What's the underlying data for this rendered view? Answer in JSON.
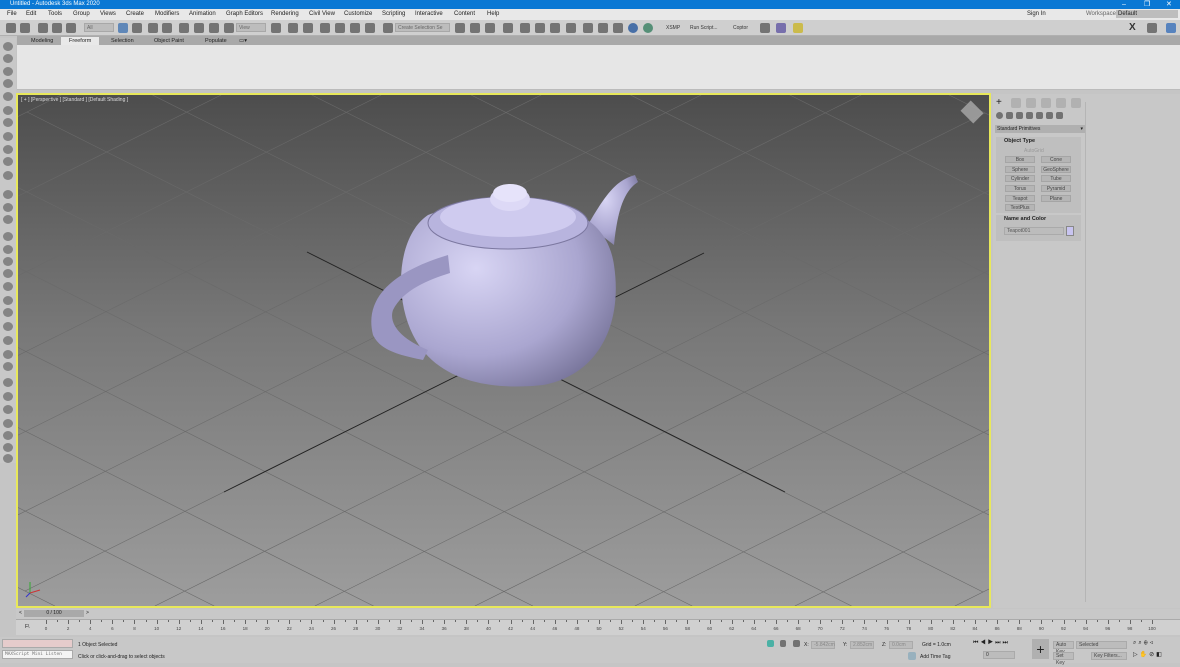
{
  "window": {
    "title": "Untitled - Autodesk 3ds Max 2020",
    "minimize": "–",
    "restore": "❐",
    "close": "✕"
  },
  "menu": [
    "File",
    "Edit",
    "Tools",
    "Group",
    "Views",
    "Create",
    "Modifiers",
    "Animation",
    "Graph Editors",
    "Rendering",
    "Civil View",
    "Customize",
    "Scripting",
    "Interactive",
    "Content",
    "Help"
  ],
  "account": {
    "sign_in": "Sign In",
    "workspaces_label": "Workspaces:",
    "workspace": "Default"
  },
  "toolbar": {
    "filter": "All",
    "ref_coord": "View",
    "selection_set": "Create Selection Se",
    "xsmp": "XSMP",
    "run_script": "Run Script...",
    "coptor": "Coptor",
    "x_label": "X"
  },
  "ribbon": {
    "tabs": [
      "Modeling",
      "Freeform",
      "Selection",
      "Object Paint",
      "Populate"
    ],
    "active_tab": "Freeform"
  },
  "viewport": {
    "label": "[ + ] [Perspective ] [Standard ] [Default Shading ]",
    "accent": "#e8e85a"
  },
  "command_panel": {
    "category": "Standard Primitives",
    "object_type_title": "Object Type",
    "autogrid": "AutoGrid",
    "buttons": [
      "Box",
      "Cone",
      "Sphere",
      "GeoSphere",
      "Cylinder",
      "Tube",
      "Torus",
      "Pyramid",
      "Teapot",
      "Plane",
      "TextPlus"
    ],
    "name_color_title": "Name and Color",
    "object_name": "Teapot001",
    "object_color": "#c8c4f0"
  },
  "timeline": {
    "frame": "0 / 100",
    "start": 0,
    "end": 100,
    "step": 2
  },
  "status": {
    "maxscript": "MAXScript Mini Listen",
    "selected": "1 Object Selected",
    "prompt": "Click or click-and-drag to select objects",
    "x_label": "X:",
    "x": "-5.842cm",
    "y_label": "Y:",
    "y": "2.852cm",
    "z_label": "Z:",
    "z": "0.0cm",
    "grid": "Grid = 1.0cm",
    "add_time_tag": "Add Time Tag",
    "auto_key": "Auto Key",
    "set_key": "Set Key",
    "key_mode": "Selected",
    "key_filters": "Key Filters...",
    "current_frame": "0"
  }
}
